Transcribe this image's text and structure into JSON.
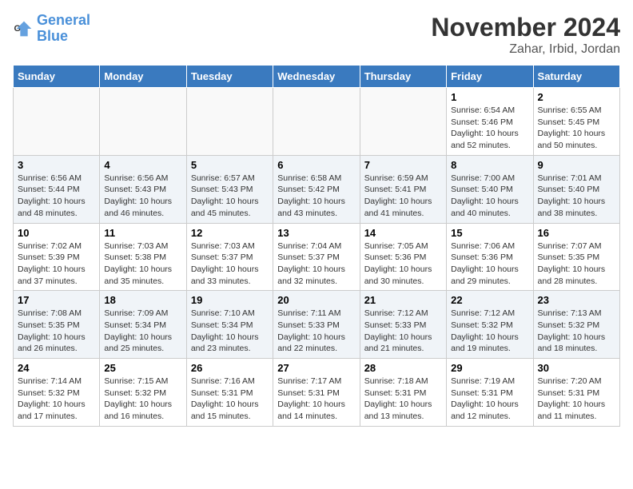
{
  "logo": {
    "line1": "General",
    "line2": "Blue"
  },
  "header": {
    "month": "November 2024",
    "location": "Zahar, Irbid, Jordan"
  },
  "weekdays": [
    "Sunday",
    "Monday",
    "Tuesday",
    "Wednesday",
    "Thursday",
    "Friday",
    "Saturday"
  ],
  "weeks": [
    [
      {
        "day": "",
        "info": ""
      },
      {
        "day": "",
        "info": ""
      },
      {
        "day": "",
        "info": ""
      },
      {
        "day": "",
        "info": ""
      },
      {
        "day": "",
        "info": ""
      },
      {
        "day": "1",
        "info": "Sunrise: 6:54 AM\nSunset: 5:46 PM\nDaylight: 10 hours\nand 52 minutes."
      },
      {
        "day": "2",
        "info": "Sunrise: 6:55 AM\nSunset: 5:45 PM\nDaylight: 10 hours\nand 50 minutes."
      }
    ],
    [
      {
        "day": "3",
        "info": "Sunrise: 6:56 AM\nSunset: 5:44 PM\nDaylight: 10 hours\nand 48 minutes."
      },
      {
        "day": "4",
        "info": "Sunrise: 6:56 AM\nSunset: 5:43 PM\nDaylight: 10 hours\nand 46 minutes."
      },
      {
        "day": "5",
        "info": "Sunrise: 6:57 AM\nSunset: 5:43 PM\nDaylight: 10 hours\nand 45 minutes."
      },
      {
        "day": "6",
        "info": "Sunrise: 6:58 AM\nSunset: 5:42 PM\nDaylight: 10 hours\nand 43 minutes."
      },
      {
        "day": "7",
        "info": "Sunrise: 6:59 AM\nSunset: 5:41 PM\nDaylight: 10 hours\nand 41 minutes."
      },
      {
        "day": "8",
        "info": "Sunrise: 7:00 AM\nSunset: 5:40 PM\nDaylight: 10 hours\nand 40 minutes."
      },
      {
        "day": "9",
        "info": "Sunrise: 7:01 AM\nSunset: 5:40 PM\nDaylight: 10 hours\nand 38 minutes."
      }
    ],
    [
      {
        "day": "10",
        "info": "Sunrise: 7:02 AM\nSunset: 5:39 PM\nDaylight: 10 hours\nand 37 minutes."
      },
      {
        "day": "11",
        "info": "Sunrise: 7:03 AM\nSunset: 5:38 PM\nDaylight: 10 hours\nand 35 minutes."
      },
      {
        "day": "12",
        "info": "Sunrise: 7:03 AM\nSunset: 5:37 PM\nDaylight: 10 hours\nand 33 minutes."
      },
      {
        "day": "13",
        "info": "Sunrise: 7:04 AM\nSunset: 5:37 PM\nDaylight: 10 hours\nand 32 minutes."
      },
      {
        "day": "14",
        "info": "Sunrise: 7:05 AM\nSunset: 5:36 PM\nDaylight: 10 hours\nand 30 minutes."
      },
      {
        "day": "15",
        "info": "Sunrise: 7:06 AM\nSunset: 5:36 PM\nDaylight: 10 hours\nand 29 minutes."
      },
      {
        "day": "16",
        "info": "Sunrise: 7:07 AM\nSunset: 5:35 PM\nDaylight: 10 hours\nand 28 minutes."
      }
    ],
    [
      {
        "day": "17",
        "info": "Sunrise: 7:08 AM\nSunset: 5:35 PM\nDaylight: 10 hours\nand 26 minutes."
      },
      {
        "day": "18",
        "info": "Sunrise: 7:09 AM\nSunset: 5:34 PM\nDaylight: 10 hours\nand 25 minutes."
      },
      {
        "day": "19",
        "info": "Sunrise: 7:10 AM\nSunset: 5:34 PM\nDaylight: 10 hours\nand 23 minutes."
      },
      {
        "day": "20",
        "info": "Sunrise: 7:11 AM\nSunset: 5:33 PM\nDaylight: 10 hours\nand 22 minutes."
      },
      {
        "day": "21",
        "info": "Sunrise: 7:12 AM\nSunset: 5:33 PM\nDaylight: 10 hours\nand 21 minutes."
      },
      {
        "day": "22",
        "info": "Sunrise: 7:12 AM\nSunset: 5:32 PM\nDaylight: 10 hours\nand 19 minutes."
      },
      {
        "day": "23",
        "info": "Sunrise: 7:13 AM\nSunset: 5:32 PM\nDaylight: 10 hours\nand 18 minutes."
      }
    ],
    [
      {
        "day": "24",
        "info": "Sunrise: 7:14 AM\nSunset: 5:32 PM\nDaylight: 10 hours\nand 17 minutes."
      },
      {
        "day": "25",
        "info": "Sunrise: 7:15 AM\nSunset: 5:32 PM\nDaylight: 10 hours\nand 16 minutes."
      },
      {
        "day": "26",
        "info": "Sunrise: 7:16 AM\nSunset: 5:31 PM\nDaylight: 10 hours\nand 15 minutes."
      },
      {
        "day": "27",
        "info": "Sunrise: 7:17 AM\nSunset: 5:31 PM\nDaylight: 10 hours\nand 14 minutes."
      },
      {
        "day": "28",
        "info": "Sunrise: 7:18 AM\nSunset: 5:31 PM\nDaylight: 10 hours\nand 13 minutes."
      },
      {
        "day": "29",
        "info": "Sunrise: 7:19 AM\nSunset: 5:31 PM\nDaylight: 10 hours\nand 12 minutes."
      },
      {
        "day": "30",
        "info": "Sunrise: 7:20 AM\nSunset: 5:31 PM\nDaylight: 10 hours\nand 11 minutes."
      }
    ]
  ]
}
